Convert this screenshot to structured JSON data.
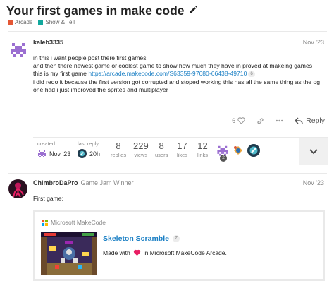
{
  "topic": {
    "title": "Your first games in make code",
    "categories": [
      {
        "name": "Arcade",
        "color": "#e45735"
      },
      {
        "name": "Show & Tell",
        "color": "#12a89d"
      }
    ]
  },
  "posts": [
    {
      "username": "kaleb3335",
      "date": "Nov '23",
      "lines": [
        "in this i want people post there first games",
        "and then there newest game or coolest game to show how much they have in proved at makeing games",
        "i did redo it because the first version got corrupted and stoped working this has all the same thing as the og",
        "one had i just improved the sprites and multiplayer"
      ],
      "line3_prefix": "this is my first game ",
      "link": "https://arcade.makecode.com/S63359-97680-66438-49710",
      "link_clicks": "6",
      "likes": "6",
      "reply_label": "Reply"
    },
    {
      "username": "ChimbroDaPro",
      "user_title": "Game Jam Winner",
      "date": "Nov '23",
      "text": "First game:",
      "onebox": {
        "source": "Microsoft MakeCode",
        "title": "Skeleton Scramble",
        "clicks": "7",
        "desc_before": "Made with",
        "desc_after": "in Microsoft MakeCode Arcade."
      }
    }
  ],
  "summary": {
    "created_label": "created",
    "created_value": "Nov '23",
    "last_reply_label": "last reply",
    "last_reply_value": "20h",
    "replies": "8",
    "replies_label": "replies",
    "views": "229",
    "views_label": "views",
    "users": "8",
    "users_label": "users",
    "likes": "17",
    "likes_label": "likes",
    "links": "12",
    "links_label": "links",
    "participant_badge": "2"
  }
}
